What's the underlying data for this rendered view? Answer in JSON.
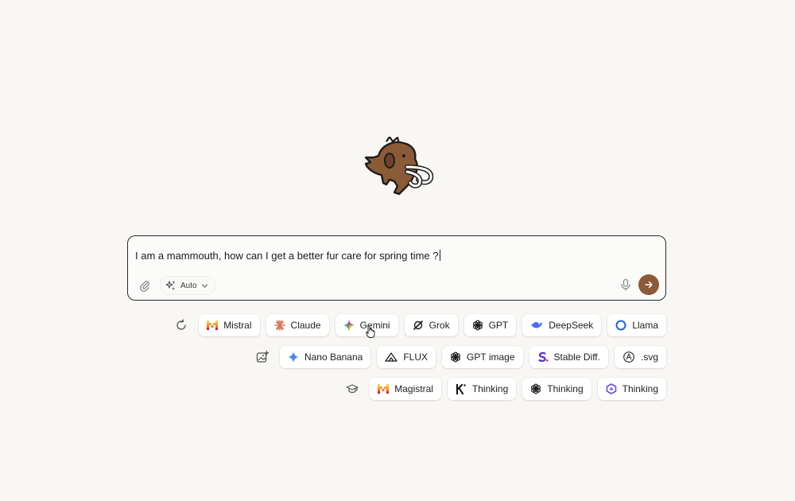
{
  "prompt": {
    "text": "I am a mammouth, how can I get a better fur care for spring time ?",
    "mode_label": "Auto"
  },
  "rows": {
    "text_models": [
      "Mistral",
      "Claude",
      "Gemini",
      "Grok",
      "GPT",
      "DeepSeek",
      "Llama"
    ],
    "image_models": [
      "Nano Banana",
      "FLUX",
      "GPT image",
      "Stable Diff.",
      ".svg"
    ],
    "thinking_models": [
      "Magistral",
      "Thinking",
      "Thinking",
      "Thinking"
    ]
  },
  "icons": {
    "row1": "refresh-sparkle-icon",
    "row2": "image-add-icon",
    "row3": "graduation-cap-icon",
    "attach": "paperclip-icon",
    "mode": "sparkles-icon",
    "mic": "microphone-icon",
    "send": "arrow-right-icon"
  },
  "colors": {
    "background": "#f8f7f3",
    "send_button": "#8b5a36",
    "mascot": "#8b5a36"
  }
}
